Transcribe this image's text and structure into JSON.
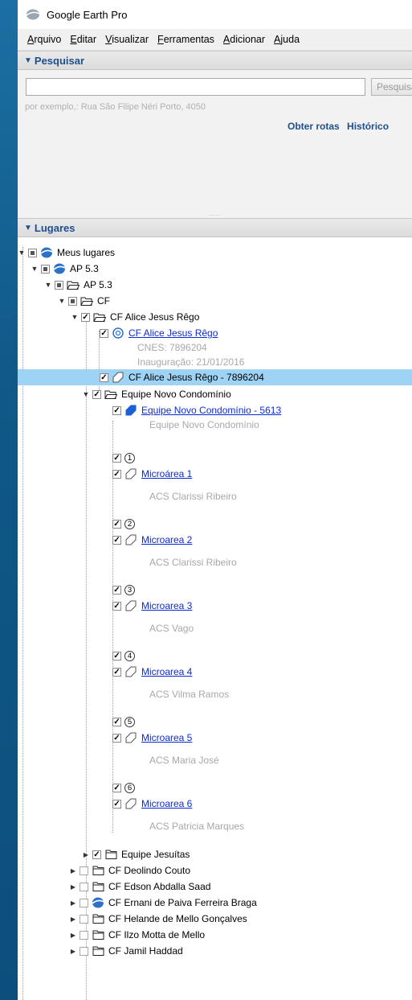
{
  "app": {
    "title": "Google Earth Pro"
  },
  "menu": [
    "Arquivo",
    "Editar",
    "Visualizar",
    "Ferramentas",
    "Adicionar",
    "Ajuda"
  ],
  "search": {
    "header": "Pesquisar",
    "input_value": "",
    "button": "Pesquisar",
    "hint": "por exemplo,: Rua São Filipe Néri Porto, 4050",
    "link_routes": "Obter rotas",
    "link_history": "Histórico"
  },
  "places": {
    "header": "Lugares",
    "rows": [
      {
        "label": "Meus lugares"
      },
      {
        "label": "AP 5.3"
      },
      {
        "label": "AP 5.3"
      },
      {
        "label": "CF"
      },
      {
        "label": "CF Alice Jesus Rêgo"
      },
      {
        "label": "CF Alice Jesus Rêgo"
      },
      {
        "label": "CNES: 7896204"
      },
      {
        "label": "Inauguração: 21/01/2016"
      },
      {
        "label": "CF Alice Jesus Rêgo - 7896204"
      },
      {
        "label": "Equipe Novo Condomínio"
      },
      {
        "label": "Equipe Novo Condomínio - 5613"
      },
      {
        "label": "Equipe Novo Condomínio"
      },
      {
        "label": "Microárea 1"
      },
      {
        "label": "ACS Clarissi Ribeiro"
      },
      {
        "label": "Microarea 2"
      },
      {
        "label": "ACS Clarissi Ribeiro"
      },
      {
        "label": "Microarea 3"
      },
      {
        "label": "ACS Vago"
      },
      {
        "label": "Microarea 4"
      },
      {
        "label": "ACS Vilma Ramos"
      },
      {
        "label": "Microarea 5"
      },
      {
        "label": "ACS Maria José"
      },
      {
        "label": "Microarea 6"
      },
      {
        "label": "ACS Patricia Marques"
      },
      {
        "label": "Equipe Jesuítas"
      },
      {
        "label": "CF Deolindo Couto"
      },
      {
        "label": "CF Edson Abdalla Saad"
      },
      {
        "label": "CF Ernani de Paiva Ferreira Braga"
      },
      {
        "label": "CF Helande de Mello Gonçalves"
      },
      {
        "label": "CF Ilzo Motta de Mello"
      },
      {
        "label": "CF Jamil Haddad"
      }
    ],
    "numbers": [
      "1",
      "2",
      "3",
      "4",
      "5",
      "6"
    ]
  },
  "colors": {
    "accent": "#1e4f8c",
    "link": "#0b2bd6",
    "selected": "#9fd3f5",
    "desktop": "#0e5a8a"
  }
}
